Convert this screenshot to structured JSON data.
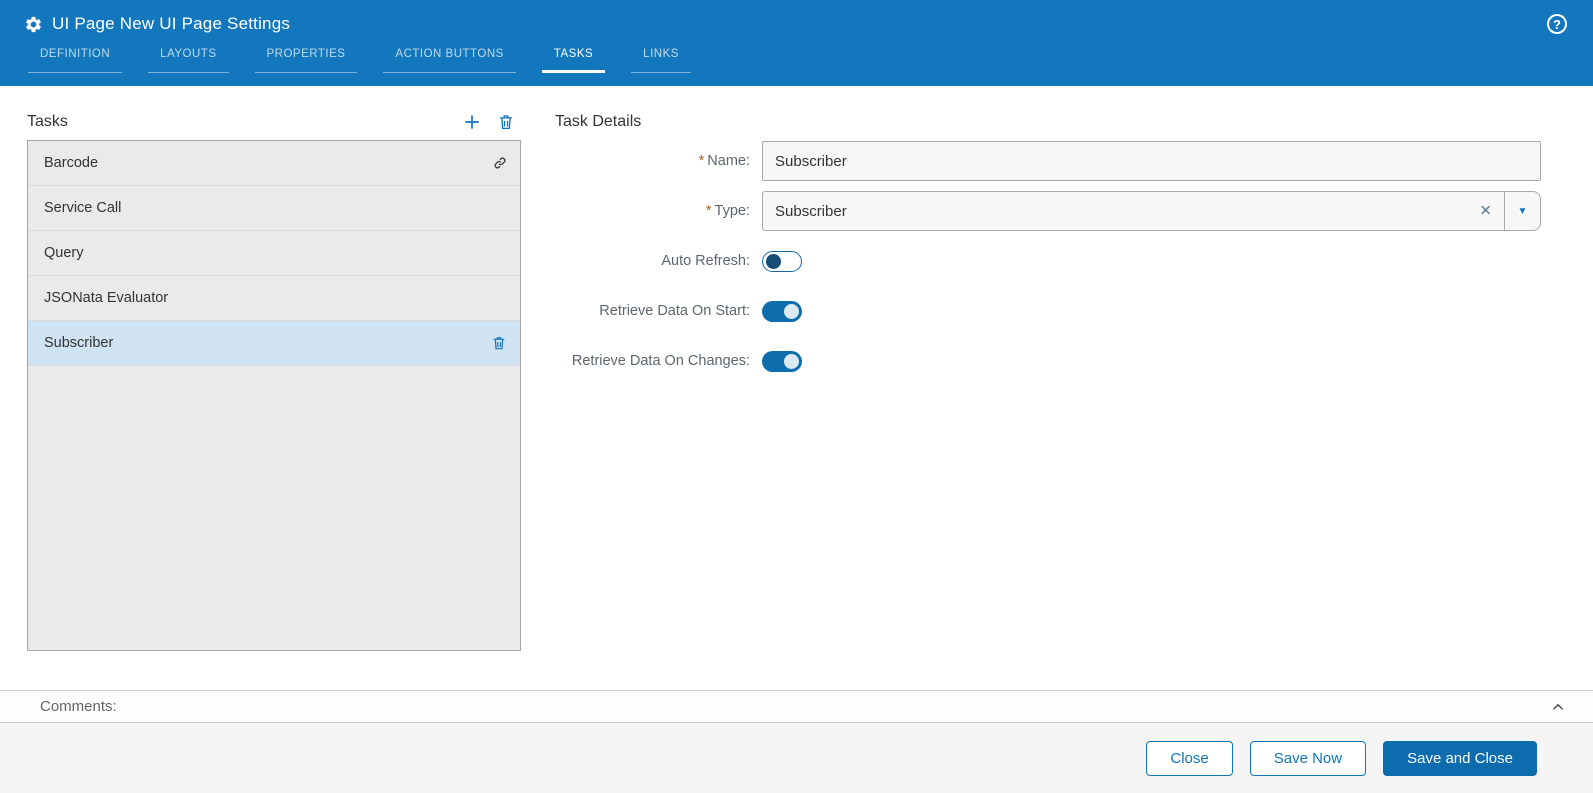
{
  "header": {
    "title": "UI Page New UI Page Settings",
    "tabs": [
      {
        "label": "DEFINITION",
        "active": false
      },
      {
        "label": "LAYOUTS",
        "active": false
      },
      {
        "label": "PROPERTIES",
        "active": false
      },
      {
        "label": "ACTION BUTTONS",
        "active": false
      },
      {
        "label": "TASKS",
        "active": true
      },
      {
        "label": "LINKS",
        "active": false
      }
    ]
  },
  "tasks_panel": {
    "title": "Tasks",
    "items": [
      {
        "label": "Barcode",
        "icon": "link-icon",
        "selected": false
      },
      {
        "label": "Service Call",
        "icon": "",
        "selected": false
      },
      {
        "label": "Query",
        "icon": "",
        "selected": false
      },
      {
        "label": "JSONata Evaluator",
        "icon": "",
        "selected": false
      },
      {
        "label": "Subscriber",
        "icon": "trash-icon",
        "selected": true
      }
    ]
  },
  "details": {
    "title": "Task Details",
    "required_marker": "*",
    "name_field": {
      "label": "Name:",
      "value": "Subscriber",
      "required": true
    },
    "type_field": {
      "label": "Type:",
      "value": "Subscriber",
      "required": true,
      "clear_glyph": "✕",
      "arrow_glyph": "▼"
    },
    "toggles": [
      {
        "label": "Auto Refresh:",
        "on": false
      },
      {
        "label": "Retrieve Data On Start:",
        "on": true
      },
      {
        "label": "Retrieve Data On Changes:",
        "on": true
      }
    ]
  },
  "comments": {
    "label": "Comments:"
  },
  "footer": {
    "buttons": [
      {
        "label": "Close",
        "primary": false
      },
      {
        "label": "Save Now",
        "primary": false
      },
      {
        "label": "Save and Close",
        "primary": true
      }
    ]
  },
  "icons": {
    "gear": "gear-icon",
    "help": "help-icon",
    "add": "plus-icon",
    "delete": "trash-icon",
    "link": "link-icon",
    "collapse": "chevron-up-icon"
  },
  "colors": {
    "header_bg": "#1377BD",
    "accent": "#1076BC",
    "selected_row_bg": "#cfe3f3",
    "list_bg": "#eaeaea",
    "input_bg": "#f7f7f7",
    "toggle_on": "#0e6dad",
    "required_star": "#b05e1e",
    "primary_button_bg": "#0c6cad",
    "footer_bg": "#f5f5f5"
  }
}
